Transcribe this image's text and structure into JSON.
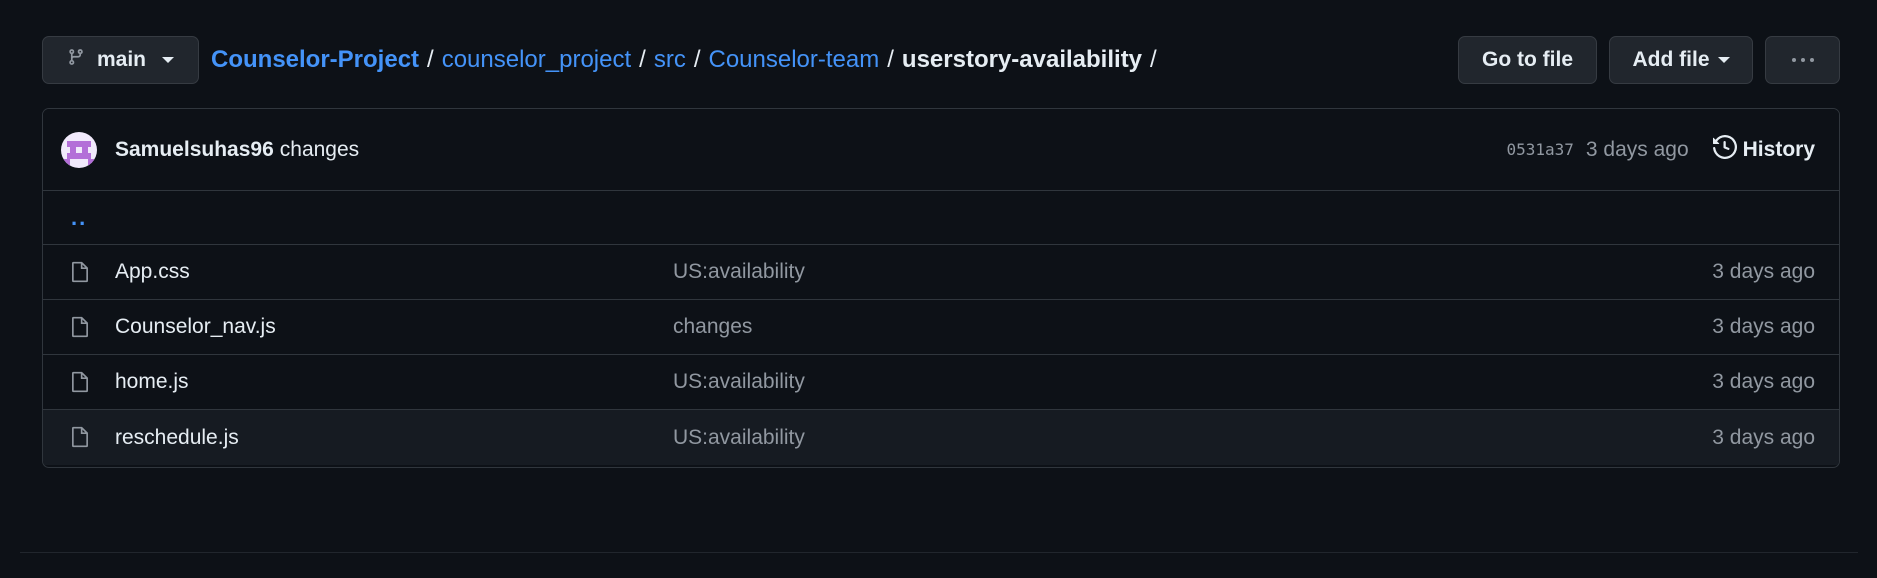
{
  "branch": {
    "label": "main"
  },
  "breadcrumb": {
    "repo": "Counselor-Project",
    "segments": [
      "counselor_project",
      "src",
      "Counselor-team"
    ],
    "current": "userstory-availability",
    "separator": "/"
  },
  "actions": {
    "go_to_file": "Go to file",
    "add_file": "Add file"
  },
  "latest_commit": {
    "author": "Samuelsuhas96",
    "message": "changes",
    "sha": "0531a37",
    "time": "3 days ago",
    "history_label": "History"
  },
  "parent_dir": {
    "label": ".."
  },
  "files": [
    {
      "name": "App.css",
      "commit": "US:availability",
      "age": "3 days ago"
    },
    {
      "name": "Counselor_nav.js",
      "commit": "changes",
      "age": "3 days ago"
    },
    {
      "name": "home.js",
      "commit": "US:availability",
      "age": "3 days ago"
    },
    {
      "name": "reschedule.js",
      "commit": "US:availability",
      "age": "3 days ago"
    }
  ],
  "colors": {
    "background": "#0d1117",
    "link": "#4493f8",
    "muted": "#9198a1",
    "border": "#30363d"
  }
}
